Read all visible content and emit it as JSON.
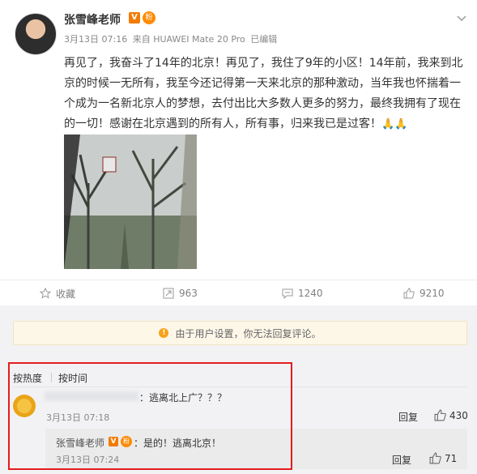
{
  "post": {
    "author": "张雪峰老师",
    "verified_badge": "V",
    "fan_badge": "粉",
    "meta": {
      "date": "3月13日 07:16",
      "source": "来自 HUAWEI Mate 20 Pro",
      "edited": "已编辑"
    },
    "text": "再见了，我奋斗了14年的北京！再见了，我住了9年的小区！14年前，我来到北京的时候一无所有，我至今还记得第一天来北京的那种激动，当年我也怀揣着一个成为一名新北京人的梦想，去付出比大多数人更多的努力，最终我拥有了现在的一切！感谢在北京遇到的所有人，所有事，归来我已是过客！",
    "emoji": "🙏🙏"
  },
  "actions": {
    "favorite_label": "收藏",
    "repost_count": "963",
    "comment_count": "1240",
    "like_count": "9210"
  },
  "notice": {
    "text": "由于用户设置，你无法回复评论。"
  },
  "sort": {
    "hot": "按热度",
    "time": "按时间"
  },
  "comment": {
    "text": "：逃离北上广？？？",
    "time": "3月13日 07:18",
    "reply_label": "回复",
    "likes": "430"
  },
  "sub_reply": {
    "author": "张雪峰老师",
    "text": "：是的！逃离北京！",
    "time": "3月13日 07:24",
    "reply_label": "回复",
    "likes": "71"
  },
  "colors": {
    "highlight_border": "#e41d1d",
    "badge_orange": "#f27b00",
    "notice_bg": "#fdf7e8"
  }
}
